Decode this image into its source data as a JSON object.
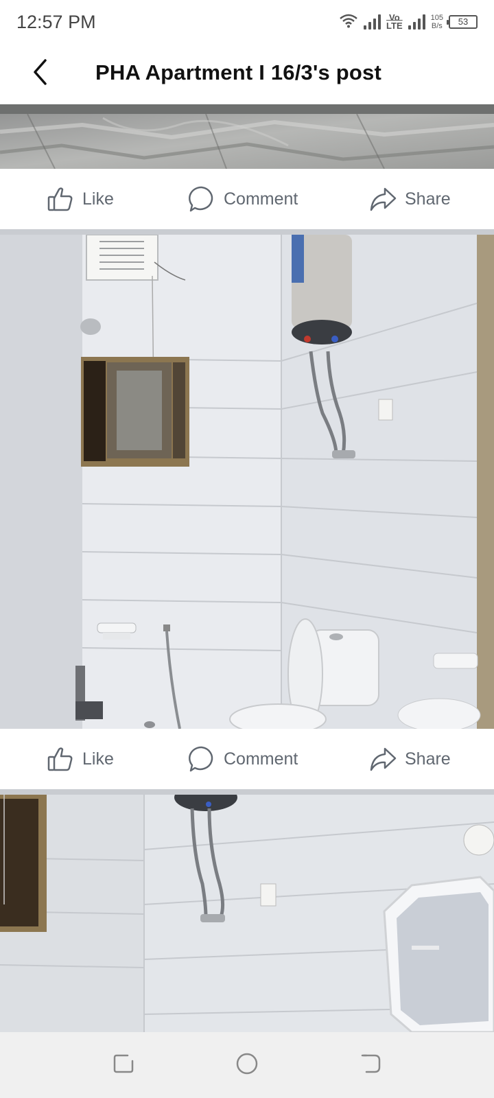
{
  "status_bar": {
    "time": "12:57 PM",
    "network_label_top": "Vo",
    "network_label_bottom": "LTE",
    "speed_value": "105",
    "speed_unit": "B/s",
    "battery": "53"
  },
  "header": {
    "title": "PHA Apartment  I 16/3's post"
  },
  "actions": {
    "like_label": "Like",
    "comment_label": "Comment",
    "share_label": "Share"
  },
  "icons": {
    "back": "chevron-left-icon",
    "like": "thumbs-up-icon",
    "comment": "speech-bubble-icon",
    "share": "share-arrow-icon",
    "nav_recent": "recent-apps-icon",
    "nav_home": "home-circle-icon",
    "nav_back": "back-nav-icon"
  },
  "colors": {
    "action_text": "#606770",
    "divider": "#c9ccd1",
    "navbar": "#f0f0f0"
  }
}
